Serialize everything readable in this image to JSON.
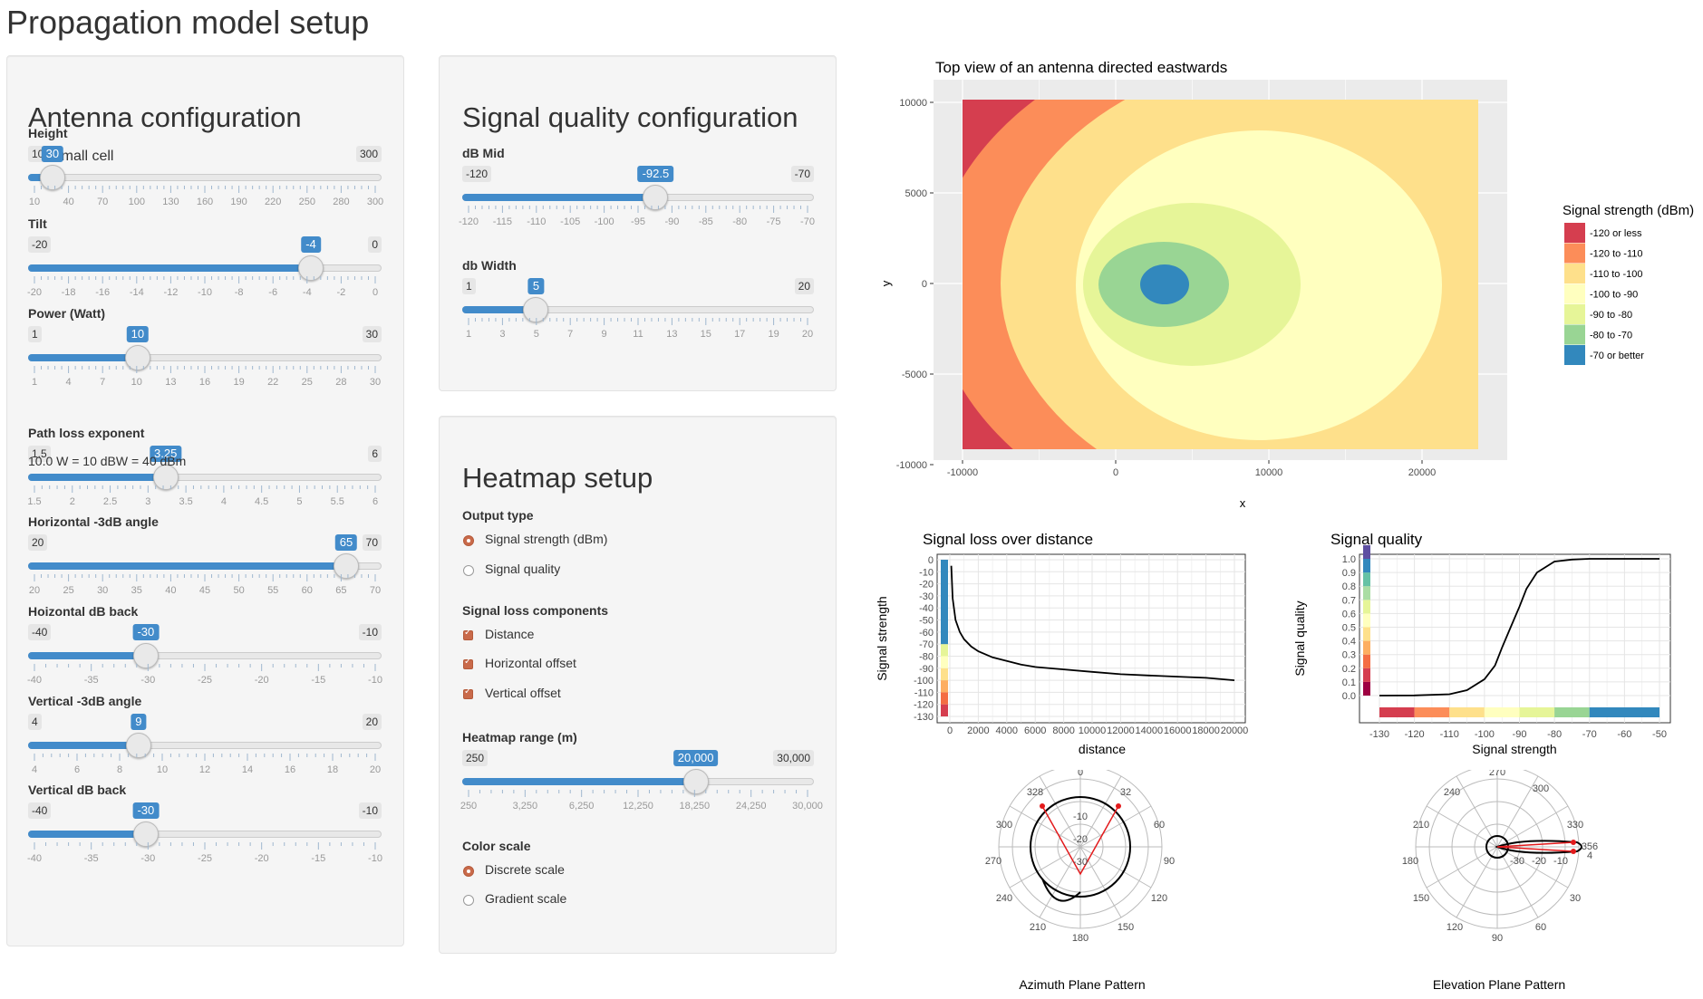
{
  "page_title": "Propagation model setup",
  "antenna": {
    "title": "Antenna configuration",
    "small_cell_label": "Small cell",
    "small_cell_checked": false,
    "sliders": [
      {
        "label": "Height",
        "min": "10",
        "max": "300",
        "value": "30",
        "frac": 0.069,
        "grid": [
          "10",
          "40",
          "70",
          "100",
          "130",
          "160",
          "190",
          "220",
          "250",
          "280",
          "300"
        ]
      },
      {
        "label": "Tilt",
        "min": "-20",
        "max": "0",
        "value": "-4",
        "frac": 0.8,
        "grid": [
          "-20",
          "-18",
          "-16",
          "-14",
          "-12",
          "-10",
          "-8",
          "-6",
          "-4",
          "-2",
          "0"
        ]
      },
      {
        "label": "Power (Watt)",
        "min": "1",
        "max": "30",
        "value": "10",
        "frac": 0.31,
        "grid": [
          "1",
          "4",
          "7",
          "10",
          "13",
          "16",
          "19",
          "22",
          "25",
          "28",
          "30"
        ]
      },
      {
        "label": "Path loss exponent",
        "min": "1.5",
        "max": "6",
        "value": "3.25",
        "frac": 0.389,
        "grid": [
          "1.5",
          "2",
          "2.5",
          "3",
          "3.5",
          "4",
          "4.5",
          "5",
          "5.5",
          "6"
        ]
      },
      {
        "label": "Horizontal -3dB angle",
        "min": "20",
        "max": "70",
        "value": "65",
        "frac": 0.9,
        "grid": [
          "20",
          "25",
          "30",
          "35",
          "40",
          "45",
          "50",
          "55",
          "60",
          "65",
          "70"
        ]
      },
      {
        "label": "Hoizontal dB back",
        "min": "-40",
        "max": "-10",
        "value": "-30",
        "frac": 0.333,
        "grid": [
          "-40",
          "-35",
          "-30",
          "-25",
          "-20",
          "-15",
          "-10"
        ]
      },
      {
        "label": "Vertical -3dB angle",
        "min": "4",
        "max": "20",
        "value": "9",
        "frac": 0.3125,
        "grid": [
          "4",
          "6",
          "8",
          "10",
          "12",
          "14",
          "16",
          "18",
          "20"
        ]
      },
      {
        "label": "Vertical dB back",
        "min": "-40",
        "max": "-10",
        "value": "-30",
        "frac": 0.333,
        "grid": [
          "-40",
          "-35",
          "-30",
          "-25",
          "-20",
          "-15",
          "-10"
        ]
      }
    ],
    "power_text": "10.0 W = 10 dBW = 40 dBm"
  },
  "signal_quality": {
    "title": "Signal quality configuration",
    "sliders": [
      {
        "label": "dB Mid",
        "min": "-120",
        "max": "-70",
        "value": "-92.5",
        "frac": 0.55,
        "grid": [
          "-120",
          "-115",
          "-110",
          "-105",
          "-100",
          "-95",
          "-90",
          "-85",
          "-80",
          "-75",
          "-70"
        ]
      },
      {
        "label": "db Width",
        "min": "1",
        "max": "20",
        "value": "5",
        "frac": 0.21,
        "grid": [
          "1",
          "3",
          "5",
          "7",
          "9",
          "11",
          "13",
          "15",
          "17",
          "19",
          "20"
        ]
      }
    ]
  },
  "heatmap_setup": {
    "title": "Heatmap setup",
    "output_type_label": "Output type",
    "output_options": [
      "Signal strength (dBm)",
      "Signal quality"
    ],
    "output_selected": 0,
    "components_label": "Signal loss components",
    "components": [
      {
        "label": "Distance",
        "checked": true
      },
      {
        "label": "Horizontal offset",
        "checked": true
      },
      {
        "label": "Vertical offset",
        "checked": true
      }
    ],
    "range_slider": {
      "label": "Heatmap range (m)",
      "min": "250",
      "max": "30,000",
      "value": "20,000",
      "frac": 0.664,
      "grid": [
        "250",
        "3,250",
        "6,250",
        "12,250",
        "18,250",
        "24,250",
        "30,000"
      ]
    },
    "color_scale_label": "Color scale",
    "color_options": [
      "Discrete scale",
      "Gradient scale"
    ],
    "color_selected": 0
  },
  "heatmap_chart": {
    "title": "Top view of an antenna directed eastwards",
    "xlabel": "x",
    "ylabel": "y",
    "xticks": [
      "-10000",
      "0",
      "10000",
      "20000"
    ],
    "yticks": [
      "10000",
      "5000",
      "0",
      "-5000",
      "-10000"
    ],
    "legend_title": "Signal strength (dBm)",
    "legend": [
      {
        "label": "-120 or less",
        "color": "#d53e4f"
      },
      {
        "label": "-120 to -110",
        "color": "#fc8d59"
      },
      {
        "label": "-110 to -100",
        "color": "#fee08b"
      },
      {
        "label": "-100 to -90",
        "color": "#ffffbf"
      },
      {
        "label": "-90 to -80",
        "color": "#e6f598"
      },
      {
        "label": "-80 to -70",
        "color": "#99d594"
      },
      {
        "label": "-70 or better",
        "color": "#3288bd"
      }
    ]
  },
  "chart_data": [
    {
      "type": "line",
      "title": "Signal loss over distance",
      "xlabel": "distance",
      "ylabel": "Signal strength",
      "xlim": [
        0,
        20000
      ],
      "ylim": [
        -130,
        0
      ],
      "xticks": [
        "0",
        "2000",
        "4000",
        "6000",
        "8000",
        "10000",
        "12000",
        "14000",
        "16000",
        "18000",
        "20000"
      ],
      "yticks": [
        "0",
        "-10",
        "-20",
        "-30",
        "-40",
        "-50",
        "-60",
        "-70",
        "-80",
        "-90",
        "-100",
        "-110",
        "-120",
        "-130"
      ],
      "x": [
        100,
        200,
        400,
        700,
        1000,
        1500,
        2000,
        3000,
        4000,
        5000,
        6000,
        8000,
        10000,
        12000,
        14000,
        16000,
        18000,
        20000
      ],
      "y": [
        -5,
        -32,
        -50,
        -60,
        -66,
        -72,
        -76,
        -81,
        -84,
        -87,
        -89,
        -91,
        -93,
        -95,
        -96,
        -97,
        -98,
        -100
      ]
    },
    {
      "type": "line",
      "title": "Signal quality",
      "xlabel": "Signal strength",
      "ylabel": "Signal quality",
      "xlim": [
        -130,
        -50
      ],
      "ylim": [
        0,
        1
      ],
      "xticks": [
        "-130",
        "-120",
        "-110",
        "-100",
        "-90",
        "-80",
        "-70",
        "-60",
        "-50"
      ],
      "yticks": [
        "1.0",
        "0.9",
        "0.8",
        "0.7",
        "0.6",
        "0.5",
        "0.4",
        "0.3",
        "0.2",
        "0.1",
        "0.0"
      ],
      "x": [
        -130,
        -120,
        -110,
        -105,
        -100,
        -97,
        -95,
        -92.5,
        -90,
        -88,
        -85,
        -80,
        -75,
        -70,
        -60,
        -50
      ],
      "y": [
        0,
        0.001,
        0.01,
        0.04,
        0.12,
        0.22,
        0.35,
        0.5,
        0.65,
        0.78,
        0.9,
        0.98,
        0.995,
        1,
        1,
        1
      ]
    },
    {
      "type": "polar",
      "title": "Azimuth Plane Pattern",
      "angle_labels": [
        "0",
        "60",
        "90",
        "120",
        "150",
        "180",
        "210",
        "240",
        "270",
        "300",
        "328",
        "32"
      ],
      "radial_labels": [
        "-10",
        "-20",
        "-30"
      ]
    },
    {
      "type": "polar",
      "title": "Elevation Plane Pattern",
      "angle_labels": [
        "270",
        "300",
        "330",
        "356",
        "4",
        "30",
        "60",
        "90",
        "120",
        "150",
        "180",
        "210",
        "240"
      ],
      "radial_labels": [
        "-10",
        "-20",
        "-30"
      ]
    }
  ]
}
